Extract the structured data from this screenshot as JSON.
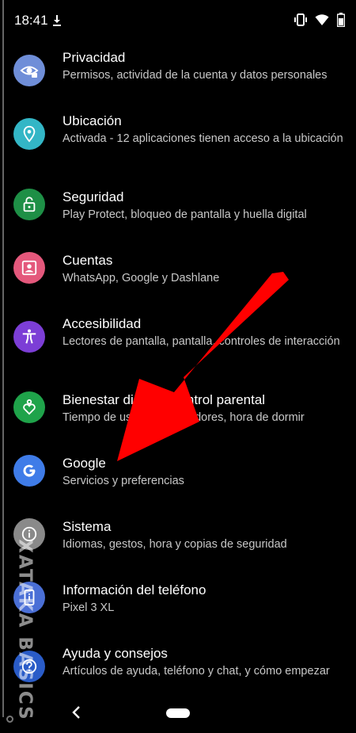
{
  "status_bar": {
    "time": "18:41",
    "icons": [
      "download-icon",
      "vibrate-icon",
      "wifi-icon",
      "battery-icon"
    ]
  },
  "settings": {
    "items": [
      {
        "title": "Privacidad",
        "subtitle": "Permisos, actividad de la cuenta y datos personales",
        "icon": "privacy-eye-icon",
        "color": "#6f8ed8"
      },
      {
        "title": "Ubicación",
        "subtitle": "Activada - 12 aplicaciones tienen acceso a la ubicación",
        "icon": "location-pin-icon",
        "color": "#33b6c6"
      },
      {
        "title": "Seguridad",
        "subtitle": "Play Protect, bloqueo de pantalla y huella digital",
        "icon": "lock-open-icon",
        "color": "#1e8f46"
      },
      {
        "title": "Cuentas",
        "subtitle": "WhatsApp, Google y Dashlane",
        "icon": "account-box-icon",
        "color": "#e4587c"
      },
      {
        "title": "Accesibilidad",
        "subtitle": "Lectores de pantalla, pantalla, controles de interacción",
        "icon": "accessibility-icon",
        "color": "#7c3ed6"
      },
      {
        "title": "Bienestar digital y control parental",
        "subtitle": "Tiempo de uso, temporizadores, hora de dormir",
        "icon": "wellbeing-heart-icon",
        "color": "#1fa34a"
      },
      {
        "title": "Google",
        "subtitle": "Servicios y preferencias",
        "icon": "google-g-icon",
        "color": "#3f7ce8"
      },
      {
        "title": "Sistema",
        "subtitle": "Idiomas, gestos, hora y copias de seguridad",
        "icon": "info-icon",
        "color": "#8a8a8a"
      },
      {
        "title": "Información del teléfono",
        "subtitle": "Pixel 3 XL",
        "icon": "phone-info-icon",
        "color": "#4a6fd6"
      },
      {
        "title": "Ayuda y consejos",
        "subtitle": "Artículos de ayuda, teléfono y chat, y cómo empezar",
        "icon": "help-icon",
        "color": "#2a5cc8"
      }
    ]
  },
  "watermark": {
    "text": "XATAKA BASICS"
  },
  "annotation": {
    "arrow_color": "#ff0000"
  }
}
